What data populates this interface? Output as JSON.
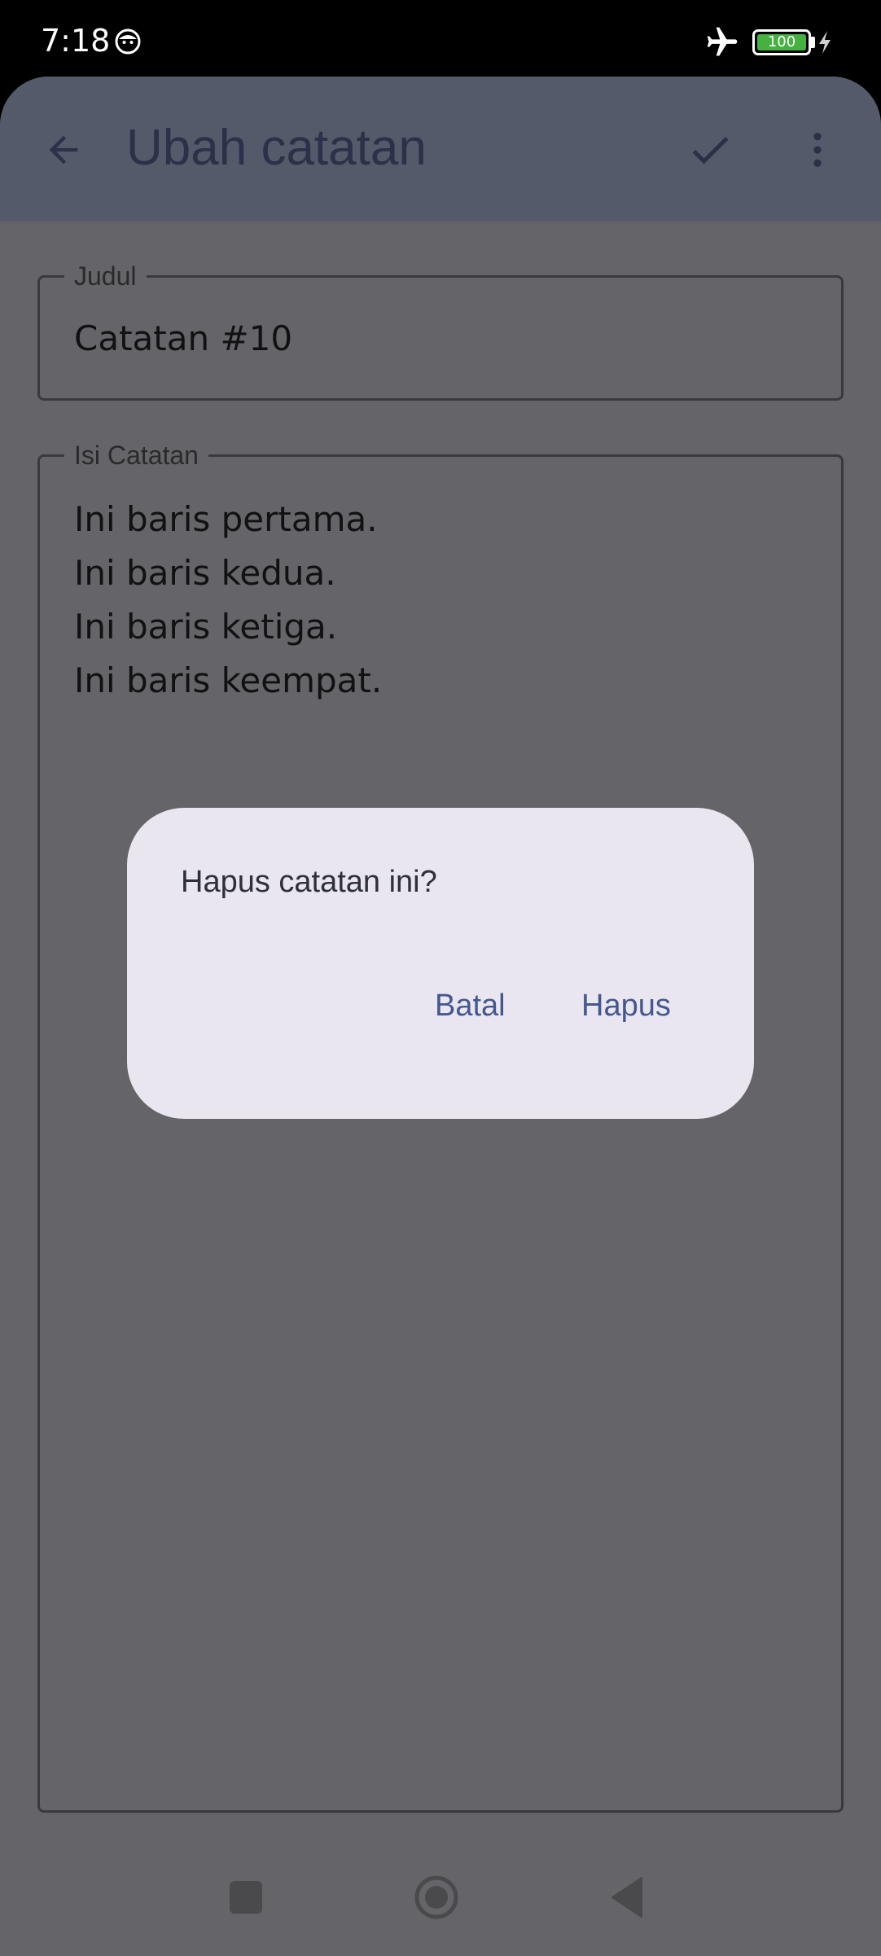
{
  "status_bar": {
    "time": "7:18",
    "battery_level": "100"
  },
  "app_bar": {
    "title": "Ubah catatan"
  },
  "title_field": {
    "label": "Judul",
    "value": "Catatan #10"
  },
  "body_field": {
    "label": "Isi Catatan",
    "lines": [
      "Ini baris pertama.",
      "Ini baris kedua.",
      "Ini baris ketiga.",
      "Ini baris keempat."
    ]
  },
  "dialog": {
    "message": "Hapus catatan ini?",
    "cancel_label": "Batal",
    "confirm_label": "Hapus"
  },
  "icons": {
    "back": "arrow-back-icon",
    "save": "check-icon",
    "more": "more-vert-icon",
    "airplane": "airplane-mode-icon",
    "charging": "bolt-icon"
  },
  "colors": {
    "dialog_background": "#e9e6f0",
    "dialog_button": "#44588f",
    "scrim": "#656468",
    "appbar": "#555a6a",
    "battery": "#46b040"
  }
}
